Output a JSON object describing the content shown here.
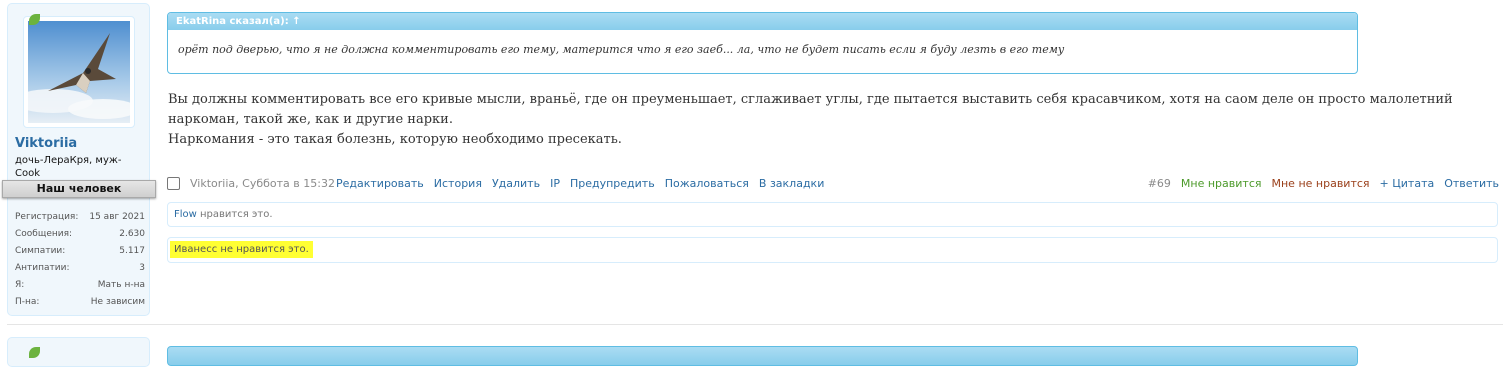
{
  "user": {
    "name": "Viktoriia",
    "title": "дочь-ЛераКря, муж-Cook",
    "banner": "Наш человек",
    "stats": [
      {
        "label": "Регистрация:",
        "value": "15 авг 2021"
      },
      {
        "label": "Сообщения:",
        "value": "2.630"
      },
      {
        "label": "Симпатии:",
        "value": "5.117"
      },
      {
        "label": "Антипатии:",
        "value": "3"
      },
      {
        "label": "Я:",
        "value": "Мать н-на"
      },
      {
        "label": "П-на:",
        "value": "Не зависим"
      }
    ]
  },
  "quote": {
    "header": "EkatRina сказал(а): ↑",
    "text": "орёт под дверью, что я не должна комментировать его тему, матерится что я его заеб... ла, что не будет писать если я буду лезть в его тему"
  },
  "message": {
    "lines": [
      "Вы должны комментировать все его кривые мысли, враньё, где он преуменьшает, сглаживает углы, где пытается выставить себя красавчиком, хотя на саом деле он просто малолетний наркоман, такой же, как и другие нарки.",
      "Наркомания - это такая болезнь, которую необходимо пресекать."
    ]
  },
  "meta": {
    "author": "Viktoriia",
    "date": ", Суббота в 15:32",
    "actions": [
      "Редактировать",
      "История",
      "Удалить",
      "IP",
      "Предупредить",
      "Пожаловаться",
      "В закладки"
    ],
    "post_number": "#69",
    "like": "Мне нравится",
    "dislike": "Мне не нравится",
    "quote": "+ Цитата",
    "reply": "Ответить"
  },
  "likes": {
    "like_user": "Flow",
    "like_text": " нравится это.",
    "dislike_text": "Иванесс не нравится это."
  },
  "colors": {
    "link": "#2b6ca3",
    "like": "#4c9a2a",
    "dislike": "#9a3f1a",
    "highlight": "#ffff33",
    "quote_border": "#5fbde3"
  }
}
